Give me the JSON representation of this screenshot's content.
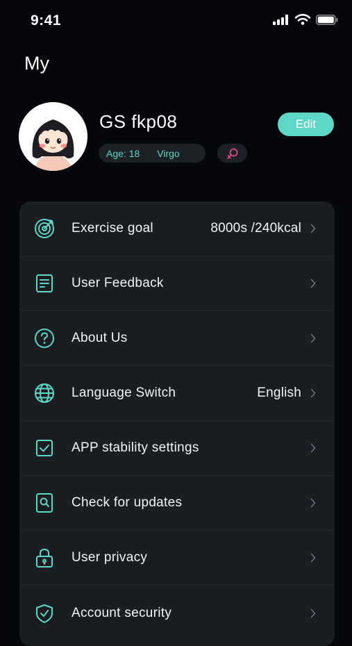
{
  "status_bar": {
    "time": "9:41"
  },
  "page": {
    "title": "My"
  },
  "profile": {
    "username": "GS fkp08",
    "edit_label": "Edit",
    "age_text": "Age: 18",
    "zodiac": "Virgo",
    "gender_icon": "female-icon"
  },
  "menu": [
    {
      "label": "Exercise goal",
      "value": "8000s /240kcal",
      "icon": "target-icon"
    },
    {
      "label": "User Feedback",
      "value": "",
      "icon": "feedback-icon"
    },
    {
      "label": "About Us",
      "value": "",
      "icon": "help-circle-icon"
    },
    {
      "label": "Language Switch",
      "value": "English",
      "icon": "globe-icon"
    },
    {
      "label": "APP stability settings",
      "value": "",
      "icon": "checkbox-icon"
    },
    {
      "label": "Check for updates",
      "value": "",
      "icon": "search-icon"
    },
    {
      "label": "User privacy",
      "value": "",
      "icon": "lock-icon"
    },
    {
      "label": "Account security",
      "value": "",
      "icon": "shield-icon"
    }
  ],
  "colors": {
    "accent": "#5fd7c7",
    "background": "#05070a",
    "card": "#1a1d21",
    "gender": "#e0498d"
  }
}
